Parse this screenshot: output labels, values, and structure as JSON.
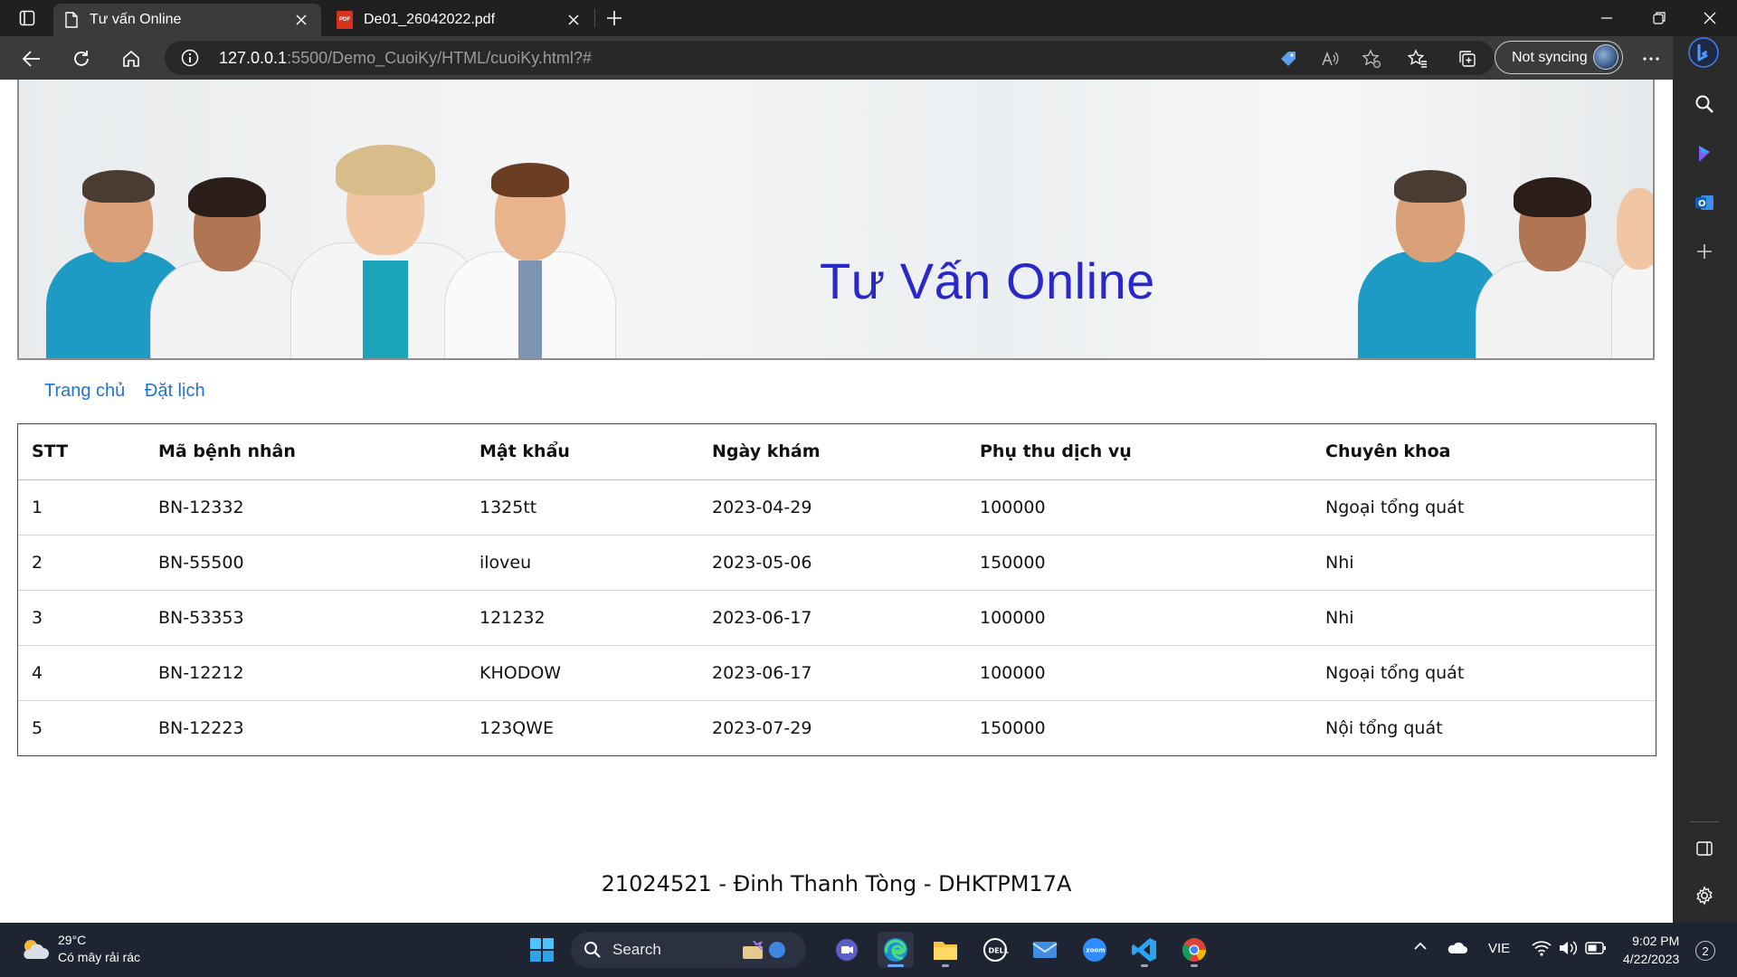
{
  "browser": {
    "tabs": [
      {
        "title": "Tư vấn Online",
        "active": true
      },
      {
        "title": "De01_26042022.pdf",
        "active": false
      }
    ],
    "address": {
      "host": "127.0.0.1",
      "rest": ":5500/Demo_CuoiKy/HTML/cuoiKy.html?#"
    },
    "sync_label": "Not syncing"
  },
  "page": {
    "banner_title": "Tư Vấn Online",
    "nav": [
      {
        "label": "Trang chủ"
      },
      {
        "label": "Đặt lịch"
      }
    ],
    "table": {
      "headers": [
        "STT",
        "Mã bệnh nhân",
        "Mật khẩu",
        "Ngày khám",
        "Phụ thu dịch vụ",
        "Chuyên khoa"
      ],
      "rows": [
        [
          "1",
          "BN-12332",
          "1325tt",
          "2023-04-29",
          "100000",
          "Ngoại tổng quát"
        ],
        [
          "2",
          "BN-55500",
          "iloveu",
          "2023-05-06",
          "150000",
          "Nhi"
        ],
        [
          "3",
          "BN-53353",
          "121232",
          "2023-06-17",
          "100000",
          "Nhi"
        ],
        [
          "4",
          "BN-12212",
          "KHODOW",
          "2023-06-17",
          "100000",
          "Ngoại tổng quát"
        ],
        [
          "5",
          "BN-12223",
          "123QWE",
          "2023-07-29",
          "150000",
          "Nội tổng quát"
        ]
      ]
    },
    "footer": "21024521 - Đinh Thanh Tòng - DHKTPM17A"
  },
  "taskbar": {
    "weather_temp": "29°C",
    "weather_desc": "Có mây rải rác",
    "search_label": "Search",
    "language": "VIE",
    "time": "9:02 PM",
    "date": "4/22/2023",
    "notifications": "2"
  },
  "colors": {
    "link": "#1f73d2",
    "banner_title": "#2a28c8",
    "chrome_dark": "#202020",
    "chrome_toolbar": "#3b3b3b",
    "taskbar": "#1f2433"
  }
}
